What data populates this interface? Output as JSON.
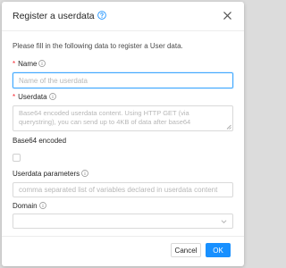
{
  "dialog": {
    "title": "Register a userdata",
    "intro": "Please fill in the following data to register a User data."
  },
  "fields": {
    "name": {
      "label": "Name",
      "required": "*",
      "placeholder": "Name of the userdata",
      "value": ""
    },
    "userdata": {
      "label": "Userdata",
      "required": "*",
      "placeholder": "Base64 encoded userdata content. Using HTTP GET (via querystring), you can send up to 4KB of data after base64",
      "value": ""
    },
    "base64": {
      "label": "Base64 encoded",
      "checked": false
    },
    "parameters": {
      "label": "Userdata parameters",
      "placeholder": "comma separated list of variables declared in userdata content",
      "value": ""
    },
    "domain": {
      "label": "Domain",
      "value": ""
    }
  },
  "buttons": {
    "cancel": "Cancel",
    "ok": "OK"
  },
  "colors": {
    "primary": "#1890ff",
    "required": "#f5222d",
    "focus_border": "#40a9ff"
  },
  "icons": {
    "title_help": "question-circle-icon",
    "close": "close-icon",
    "field_info": "info-circle-icon",
    "domain_dropdown": "chevron-down-icon"
  }
}
